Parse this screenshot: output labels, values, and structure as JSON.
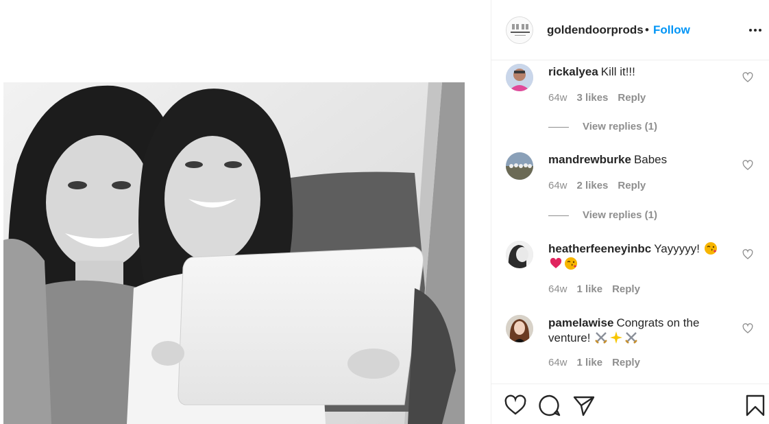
{
  "post": {
    "username": "goldendoorprods",
    "separator": "•",
    "follow_label": "Follow",
    "avatar_text": "GOLDEN DOOR"
  },
  "comments": [
    {
      "username": "rickalyea",
      "text": "Kill it!!!",
      "age": "64w",
      "likes": "3 likes",
      "reply_label": "Reply",
      "view_replies": "View replies (1)"
    },
    {
      "username": "mandrewburke",
      "text": "Babes",
      "age": "64w",
      "likes": "2 likes",
      "reply_label": "Reply",
      "view_replies": "View replies (1)"
    },
    {
      "username": "heatherfeeneyinbc",
      "text": "Yayyyyy!",
      "age": "64w",
      "likes": "1 like",
      "reply_label": "Reply"
    },
    {
      "username": "pamelawise",
      "text": "Congrats on the venture!",
      "age": "64w",
      "likes": "1 like",
      "reply_label": "Reply"
    }
  ],
  "icons": {
    "like": "heart-icon",
    "comment": "comment-icon",
    "share": "paper-plane-icon",
    "save": "bookmark-icon",
    "more": "more-options-icon"
  },
  "colors": {
    "follow": "#0095f6",
    "text": "#262626",
    "muted": "#8e8e8e",
    "border": "#efefef"
  }
}
